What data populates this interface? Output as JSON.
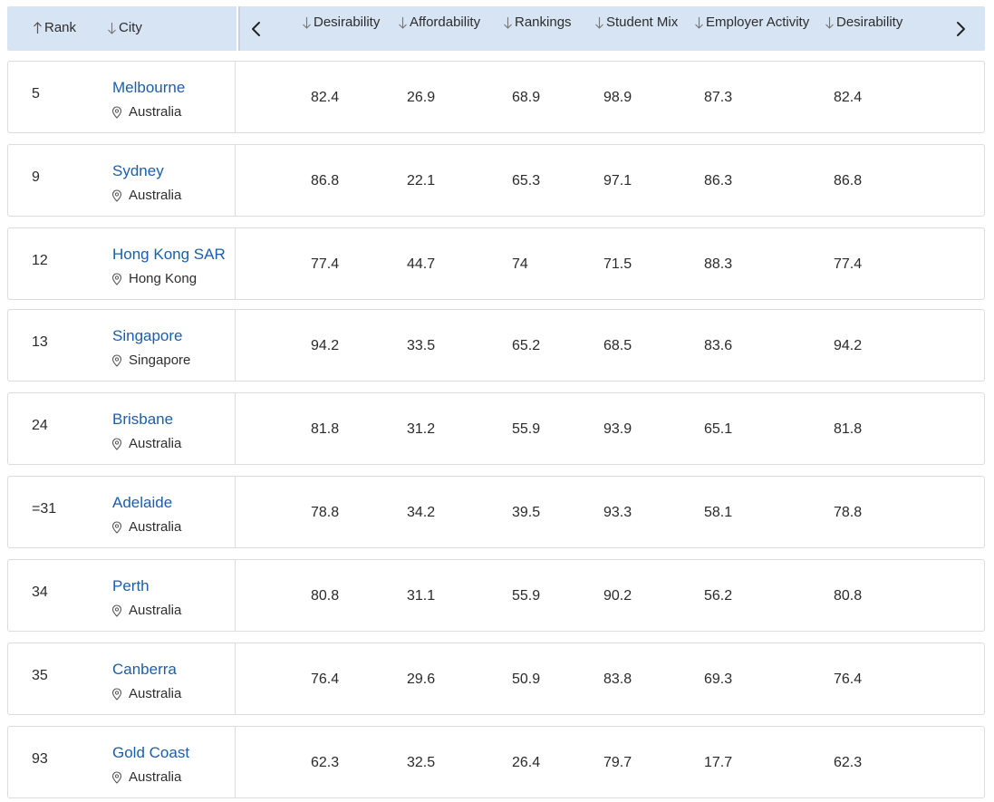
{
  "header": {
    "columns": [
      {
        "label": "Rank",
        "sort": "up"
      },
      {
        "label": "City",
        "sort": "down"
      },
      {
        "label": "Desirability",
        "sort": "down"
      },
      {
        "label": "Affordability",
        "sort": "down"
      },
      {
        "label": "Rankings",
        "sort": "down"
      },
      {
        "label": "Student Mix",
        "sort": "down"
      },
      {
        "label": "Employer Activity",
        "sort": "down"
      },
      {
        "label": "Desirability",
        "sort": "down"
      }
    ],
    "prev_icon": "chevron-left-icon",
    "next_icon": "chevron-right-icon"
  },
  "rows": [
    {
      "rank": "5",
      "city": "Melbourne",
      "country": "Australia",
      "values": [
        "82.4",
        "26.9",
        "68.9",
        "98.9",
        "87.3",
        "82.4"
      ]
    },
    {
      "rank": "9",
      "city": "Sydney",
      "country": "Australia",
      "values": [
        "86.8",
        "22.1",
        "65.3",
        "97.1",
        "86.3",
        "86.8"
      ]
    },
    {
      "rank": "12",
      "city": "Hong Kong SAR",
      "country": "Hong Kong",
      "values": [
        "77.4",
        "44.7",
        "74",
        "71.5",
        "88.3",
        "77.4"
      ]
    },
    {
      "rank": "13",
      "city": "Singapore",
      "country": "Singapore",
      "values": [
        "94.2",
        "33.5",
        "65.2",
        "68.5",
        "83.6",
        "94.2"
      ]
    },
    {
      "rank": "24",
      "city": "Brisbane",
      "country": "Australia",
      "values": [
        "81.8",
        "31.2",
        "55.9",
        "93.9",
        "65.1",
        "81.8"
      ]
    },
    {
      "rank": "=31",
      "city": "Adelaide",
      "country": "Australia",
      "values": [
        "78.8",
        "34.2",
        "39.5",
        "93.3",
        "58.1",
        "78.8"
      ]
    },
    {
      "rank": "34",
      "city": "Perth",
      "country": "Australia",
      "values": [
        "80.8",
        "31.1",
        "55.9",
        "90.2",
        "56.2",
        "80.8"
      ]
    },
    {
      "rank": "35",
      "city": "Canberra",
      "country": "Australia",
      "values": [
        "76.4",
        "29.6",
        "50.9",
        "83.8",
        "69.3",
        "76.4"
      ]
    },
    {
      "rank": "93",
      "city": "Gold Coast",
      "country": "Australia",
      "values": [
        "62.3",
        "32.5",
        "26.4",
        "79.7",
        "17.7",
        "62.3"
      ]
    }
  ],
  "colors": {
    "header_bg": "#d6e4f3",
    "link": "#1b5eab",
    "border": "#dcdcdc"
  }
}
